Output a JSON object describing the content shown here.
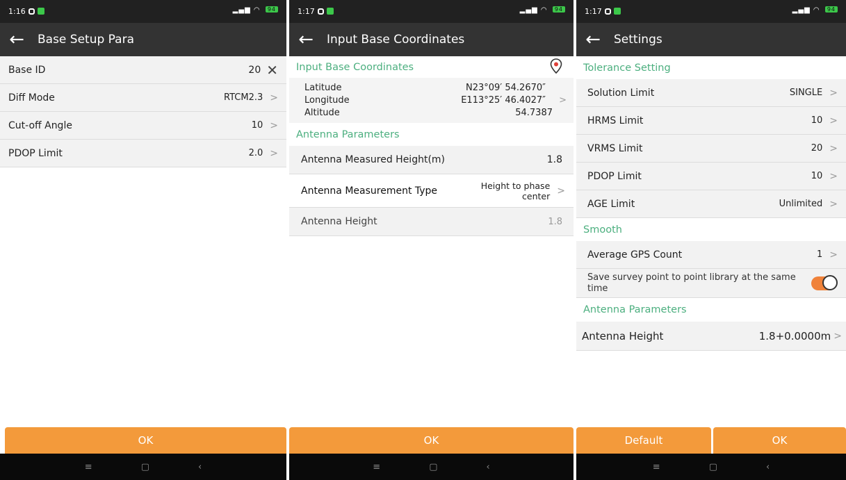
{
  "screen1": {
    "status_time": "1:16",
    "battery": "94",
    "title": "Base Setup Para",
    "rows": [
      {
        "label": "Base ID",
        "value": "20"
      },
      {
        "label": "Diff Mode",
        "value": "RTCM2.3"
      },
      {
        "label": "Cut-off Angle",
        "value": "10"
      },
      {
        "label": "PDOP Limit",
        "value": "2.0"
      }
    ],
    "ok_label": "OK"
  },
  "screen2": {
    "status_time": "1:17",
    "battery": "94",
    "title": "Input Base Coordinates",
    "section1": "Input Base Coordinates",
    "coords": [
      {
        "label": "Latitude",
        "value": "N23°09′ 54.2670″"
      },
      {
        "label": "Longitude",
        "value": "E113°25′ 46.4027″"
      },
      {
        "label": "Altitude",
        "value": "54.7387"
      }
    ],
    "section2": "Antenna Parameters",
    "antenna_rows": [
      {
        "label": "Antenna Measured Height(m)",
        "value": "1.8"
      },
      {
        "label": "Antenna Measurement Type",
        "value": "Height to phase center"
      },
      {
        "label": "Antenna Height",
        "value": "1.8"
      }
    ],
    "ok_label": "OK"
  },
  "screen3": {
    "status_time": "1:17",
    "battery": "94",
    "title": "Settings",
    "section_tolerance": "Tolerance Setting",
    "tolerance_rows": [
      {
        "label": "Solution Limit",
        "value": "SINGLE"
      },
      {
        "label": "HRMS Limit",
        "value": "10"
      },
      {
        "label": "VRMS Limit",
        "value": "20"
      },
      {
        "label": "PDOP Limit",
        "value": "10"
      },
      {
        "label": "AGE Limit",
        "value": "Unlimited"
      }
    ],
    "section_smooth": "Smooth",
    "avg_gps_label": "Average GPS Count",
    "avg_gps_value": "1",
    "save_label": "Save survey point to point library at the same time",
    "section_antenna": "Antenna Parameters",
    "antenna_height_label": "Antenna Height",
    "antenna_height_value": "1.8+0.0000m",
    "default_label": "Default",
    "ok_label": "OK"
  },
  "colors": {
    "accent_green": "#4caf7f",
    "button_orange": "#f39a3b",
    "toggle_orange": "#f0823a",
    "titlebar": "#333333",
    "statusbar": "#212121"
  }
}
